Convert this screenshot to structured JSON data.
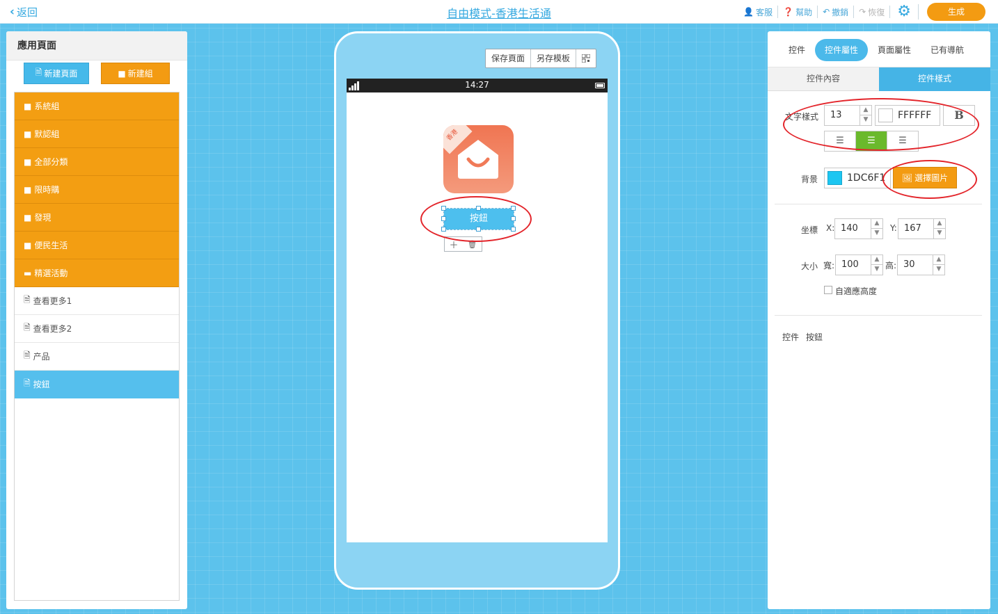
{
  "header": {
    "back_label": "返回",
    "title": "自由模式-香港生活通",
    "tools": {
      "service": "客服",
      "help": "幫助",
      "undo": "撤銷",
      "redo": "恢復",
      "generate": "生成"
    }
  },
  "left_panel": {
    "title": "應用頁面",
    "new_page_label": "新建頁面",
    "new_group_label": "新建組",
    "items": [
      {
        "label": "系統組",
        "type": "group"
      },
      {
        "label": "默認組",
        "type": "group"
      },
      {
        "label": "全部分類",
        "type": "group"
      },
      {
        "label": "限時購",
        "type": "group"
      },
      {
        "label": "發現",
        "type": "group"
      },
      {
        "label": "便民生活",
        "type": "group"
      },
      {
        "label": "精選活動",
        "type": "group-open"
      },
      {
        "label": "查看更多1",
        "type": "page"
      },
      {
        "label": "查看更多2",
        "type": "page"
      },
      {
        "label": "产品",
        "type": "page"
      },
      {
        "label": "按鈕",
        "type": "page",
        "selected": true
      }
    ]
  },
  "phone": {
    "toolbar": {
      "save_page": "保存頁面",
      "save_template": "另存模板"
    },
    "status_time": "14:27",
    "logo_badge": "香港",
    "widget_button_label": "按鈕",
    "controls": {
      "add_icon": "＋",
      "delete_icon": "🗑"
    }
  },
  "right_panel": {
    "tabs": [
      "控件",
      "控件屬性",
      "頁面屬性",
      "已有導航"
    ],
    "active_tab": "控件屬性",
    "subtabs": [
      "控件內容",
      "控件樣式"
    ],
    "active_subtab": "控件樣式",
    "text_style": {
      "label": "文字樣式",
      "font_size": "13",
      "color": "FFFFFF",
      "bold_label": "B",
      "align_options": [
        "left",
        "center",
        "right"
      ],
      "align_selected": "center"
    },
    "background": {
      "label": "背景",
      "color": "1DC6F1",
      "choose_image_label": "選擇圖片"
    },
    "position": {
      "label": "坐標",
      "x_label": "X:",
      "x_value": "140",
      "y_label": "Y:",
      "y_value": "167"
    },
    "size": {
      "label": "大小",
      "width_label": "寬:",
      "width_value": "100",
      "height_label": "高:",
      "height_value": "30",
      "auto_height_label": "自適應高度",
      "auto_height_checked": false
    },
    "control_info": {
      "label": "控件",
      "value": "按鈕"
    }
  },
  "colors": {
    "accent_blue": "#4bb9ea",
    "accent_orange": "#f39b12",
    "align_active_green": "#6ab92c",
    "canvas_bg": "#5cc2ec",
    "annotation_red": "#e3252b"
  }
}
